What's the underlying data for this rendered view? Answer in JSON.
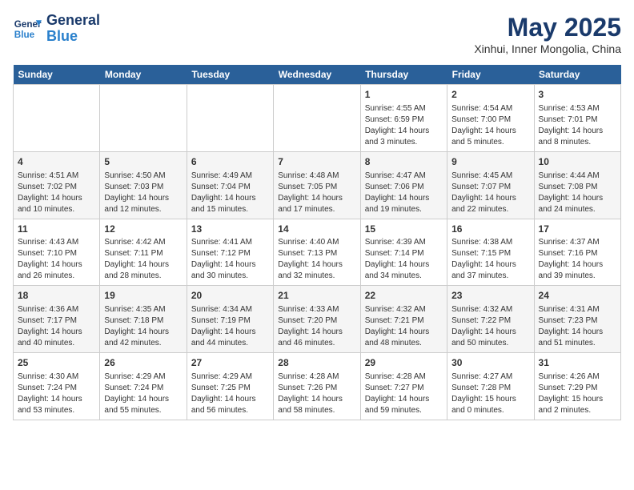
{
  "header": {
    "logo_line1": "General",
    "logo_line2": "Blue",
    "main_title": "May 2025",
    "subtitle": "Xinhui, Inner Mongolia, China"
  },
  "calendar": {
    "days_of_week": [
      "Sunday",
      "Monday",
      "Tuesday",
      "Wednesday",
      "Thursday",
      "Friday",
      "Saturday"
    ],
    "weeks": [
      [
        {
          "day": "",
          "lines": []
        },
        {
          "day": "",
          "lines": []
        },
        {
          "day": "",
          "lines": []
        },
        {
          "day": "",
          "lines": []
        },
        {
          "day": "1",
          "lines": [
            "Sunrise: 4:55 AM",
            "Sunset: 6:59 PM",
            "Daylight: 14 hours",
            "and 3 minutes."
          ]
        },
        {
          "day": "2",
          "lines": [
            "Sunrise: 4:54 AM",
            "Sunset: 7:00 PM",
            "Daylight: 14 hours",
            "and 5 minutes."
          ]
        },
        {
          "day": "3",
          "lines": [
            "Sunrise: 4:53 AM",
            "Sunset: 7:01 PM",
            "Daylight: 14 hours",
            "and 8 minutes."
          ]
        }
      ],
      [
        {
          "day": "4",
          "lines": [
            "Sunrise: 4:51 AM",
            "Sunset: 7:02 PM",
            "Daylight: 14 hours",
            "and 10 minutes."
          ]
        },
        {
          "day": "5",
          "lines": [
            "Sunrise: 4:50 AM",
            "Sunset: 7:03 PM",
            "Daylight: 14 hours",
            "and 12 minutes."
          ]
        },
        {
          "day": "6",
          "lines": [
            "Sunrise: 4:49 AM",
            "Sunset: 7:04 PM",
            "Daylight: 14 hours",
            "and 15 minutes."
          ]
        },
        {
          "day": "7",
          "lines": [
            "Sunrise: 4:48 AM",
            "Sunset: 7:05 PM",
            "Daylight: 14 hours",
            "and 17 minutes."
          ]
        },
        {
          "day": "8",
          "lines": [
            "Sunrise: 4:47 AM",
            "Sunset: 7:06 PM",
            "Daylight: 14 hours",
            "and 19 minutes."
          ]
        },
        {
          "day": "9",
          "lines": [
            "Sunrise: 4:45 AM",
            "Sunset: 7:07 PM",
            "Daylight: 14 hours",
            "and 22 minutes."
          ]
        },
        {
          "day": "10",
          "lines": [
            "Sunrise: 4:44 AM",
            "Sunset: 7:08 PM",
            "Daylight: 14 hours",
            "and 24 minutes."
          ]
        }
      ],
      [
        {
          "day": "11",
          "lines": [
            "Sunrise: 4:43 AM",
            "Sunset: 7:10 PM",
            "Daylight: 14 hours",
            "and 26 minutes."
          ]
        },
        {
          "day": "12",
          "lines": [
            "Sunrise: 4:42 AM",
            "Sunset: 7:11 PM",
            "Daylight: 14 hours",
            "and 28 minutes."
          ]
        },
        {
          "day": "13",
          "lines": [
            "Sunrise: 4:41 AM",
            "Sunset: 7:12 PM",
            "Daylight: 14 hours",
            "and 30 minutes."
          ]
        },
        {
          "day": "14",
          "lines": [
            "Sunrise: 4:40 AM",
            "Sunset: 7:13 PM",
            "Daylight: 14 hours",
            "and 32 minutes."
          ]
        },
        {
          "day": "15",
          "lines": [
            "Sunrise: 4:39 AM",
            "Sunset: 7:14 PM",
            "Daylight: 14 hours",
            "and 34 minutes."
          ]
        },
        {
          "day": "16",
          "lines": [
            "Sunrise: 4:38 AM",
            "Sunset: 7:15 PM",
            "Daylight: 14 hours",
            "and 37 minutes."
          ]
        },
        {
          "day": "17",
          "lines": [
            "Sunrise: 4:37 AM",
            "Sunset: 7:16 PM",
            "Daylight: 14 hours",
            "and 39 minutes."
          ]
        }
      ],
      [
        {
          "day": "18",
          "lines": [
            "Sunrise: 4:36 AM",
            "Sunset: 7:17 PM",
            "Daylight: 14 hours",
            "and 40 minutes."
          ]
        },
        {
          "day": "19",
          "lines": [
            "Sunrise: 4:35 AM",
            "Sunset: 7:18 PM",
            "Daylight: 14 hours",
            "and 42 minutes."
          ]
        },
        {
          "day": "20",
          "lines": [
            "Sunrise: 4:34 AM",
            "Sunset: 7:19 PM",
            "Daylight: 14 hours",
            "and 44 minutes."
          ]
        },
        {
          "day": "21",
          "lines": [
            "Sunrise: 4:33 AM",
            "Sunset: 7:20 PM",
            "Daylight: 14 hours",
            "and 46 minutes."
          ]
        },
        {
          "day": "22",
          "lines": [
            "Sunrise: 4:32 AM",
            "Sunset: 7:21 PM",
            "Daylight: 14 hours",
            "and 48 minutes."
          ]
        },
        {
          "day": "23",
          "lines": [
            "Sunrise: 4:32 AM",
            "Sunset: 7:22 PM",
            "Daylight: 14 hours",
            "and 50 minutes."
          ]
        },
        {
          "day": "24",
          "lines": [
            "Sunrise: 4:31 AM",
            "Sunset: 7:23 PM",
            "Daylight: 14 hours",
            "and 51 minutes."
          ]
        }
      ],
      [
        {
          "day": "25",
          "lines": [
            "Sunrise: 4:30 AM",
            "Sunset: 7:24 PM",
            "Daylight: 14 hours",
            "and 53 minutes."
          ]
        },
        {
          "day": "26",
          "lines": [
            "Sunrise: 4:29 AM",
            "Sunset: 7:24 PM",
            "Daylight: 14 hours",
            "and 55 minutes."
          ]
        },
        {
          "day": "27",
          "lines": [
            "Sunrise: 4:29 AM",
            "Sunset: 7:25 PM",
            "Daylight: 14 hours",
            "and 56 minutes."
          ]
        },
        {
          "day": "28",
          "lines": [
            "Sunrise: 4:28 AM",
            "Sunset: 7:26 PM",
            "Daylight: 14 hours",
            "and 58 minutes."
          ]
        },
        {
          "day": "29",
          "lines": [
            "Sunrise: 4:28 AM",
            "Sunset: 7:27 PM",
            "Daylight: 14 hours",
            "and 59 minutes."
          ]
        },
        {
          "day": "30",
          "lines": [
            "Sunrise: 4:27 AM",
            "Sunset: 7:28 PM",
            "Daylight: 15 hours",
            "and 0 minutes."
          ]
        },
        {
          "day": "31",
          "lines": [
            "Sunrise: 4:26 AM",
            "Sunset: 7:29 PM",
            "Daylight: 15 hours",
            "and 2 minutes."
          ]
        }
      ]
    ]
  }
}
